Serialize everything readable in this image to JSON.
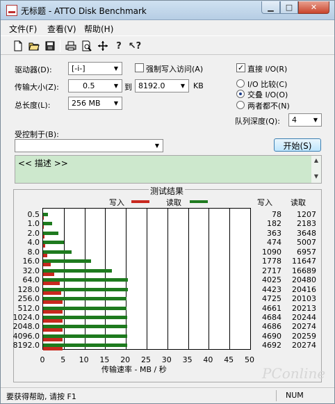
{
  "window": {
    "title": "无标题 - ATTO Disk Benchmark"
  },
  "menu": {
    "file": "文件(F)",
    "view": "查看(V)",
    "help": "帮助(H)"
  },
  "toolbar": {
    "icons": [
      "new-icon",
      "open-icon",
      "save-icon",
      "print-icon",
      "print-preview-icon",
      "move-icon",
      "help-icon",
      "context-help-icon"
    ]
  },
  "settings": {
    "drive_label": "驱动器(D):",
    "drive_value": "[-i-]",
    "force_write_label": "强制写入访问(A)",
    "direct_io_label": "直接 I/O(R)",
    "transfer_label": "传输大小(Z):",
    "transfer_from": "0.5",
    "to_label": "到",
    "transfer_to": "8192.0",
    "unit": "KB",
    "io_compare_label": "I/O 比较(C)",
    "overlap_io_label": "交叠 I/O(O)",
    "neither_label": "两者都不(N)",
    "total_length_label": "总长度(L):",
    "total_length_value": "256 MB",
    "queue_depth_label": "队列深度(Q):",
    "queue_depth_value": "4",
    "controlled_by_label": "受控制于(B):",
    "controlled_by_value": "",
    "start_label": "开始(S)",
    "description": "<< 描述 >>"
  },
  "results": {
    "title": "测试结果",
    "write_legend": "写入",
    "read_legend": "读取",
    "write_col": "写入",
    "read_col": "读取",
    "x_axis_label": "传输速率 - MB / 秒"
  },
  "chart_data": {
    "type": "bar",
    "orientation": "horizontal",
    "title": "测试结果",
    "xlabel": "传输速率 - MB / 秒",
    "xlim": [
      0,
      50
    ],
    "xticks": [
      "0",
      "5",
      "10",
      "15",
      "20",
      "25",
      "30",
      "35",
      "40",
      "45",
      "50"
    ],
    "categories": [
      "0.5",
      "1.0",
      "2.0",
      "4.0",
      "8.0",
      "16.0",
      "32.0",
      "64.0",
      "128.0",
      "256.0",
      "512.0",
      "1024.0",
      "2048.0",
      "4096.0",
      "8192.0"
    ],
    "series": [
      {
        "name": "写入",
        "color": "#c8281e",
        "values": [
          0.08,
          0.18,
          0.36,
          0.47,
          1.09,
          1.78,
          2.72,
          4.03,
          4.42,
          4.73,
          4.66,
          4.68,
          4.69,
          4.69,
          4.69
        ],
        "labels": [
          "78",
          "182",
          "363",
          "474",
          "1090",
          "1778",
          "2717",
          "4025",
          "4423",
          "4725",
          "4661",
          "4684",
          "4686",
          "4690",
          "4692"
        ]
      },
      {
        "name": "读取",
        "color": "#1e7a1e",
        "values": [
          1.21,
          2.18,
          3.65,
          5.01,
          6.96,
          11.65,
          16.69,
          20.48,
          20.42,
          20.1,
          20.21,
          20.24,
          20.27,
          20.26,
          20.27
        ],
        "labels": [
          "1207",
          "2183",
          "3648",
          "5007",
          "6957",
          "11647",
          "16689",
          "20480",
          "20416",
          "20103",
          "20213",
          "20244",
          "20274",
          "20259",
          "20274"
        ]
      }
    ],
    "grid": true,
    "legend": "top"
  },
  "status": {
    "help_text": "要获得帮助, 请按 F1",
    "num": "NUM"
  },
  "watermark": "PConline"
}
